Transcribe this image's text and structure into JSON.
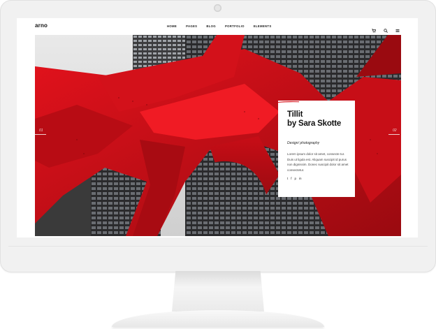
{
  "header": {
    "logo": "arno",
    "menu": [
      "HOME",
      "PAGES",
      "BLOG",
      "PORTFOLIO",
      "ELEMENTS"
    ],
    "icons": [
      "cart-icon",
      "search-icon",
      "menu-icon"
    ]
  },
  "slider": {
    "prev_number": "01",
    "next_number": "02"
  },
  "card": {
    "title_line1": "Tillit",
    "title_line2": "by Sara Skotte",
    "category": "Design/ photography",
    "body": "Lorem ipsum dolor sit amet, consecte tur. Duis ut ligula est. Aliquam suscipit id purus non dignissim. Donec suscipit dolor sit amet consectetur.",
    "social": [
      "twitter-icon",
      "facebook-icon",
      "pinterest-icon",
      "linkedin-icon"
    ],
    "social_glyphs": [
      "t",
      "f",
      "p",
      "in"
    ]
  },
  "colors": {
    "accent": "#d8101a",
    "dark": "#111111"
  }
}
